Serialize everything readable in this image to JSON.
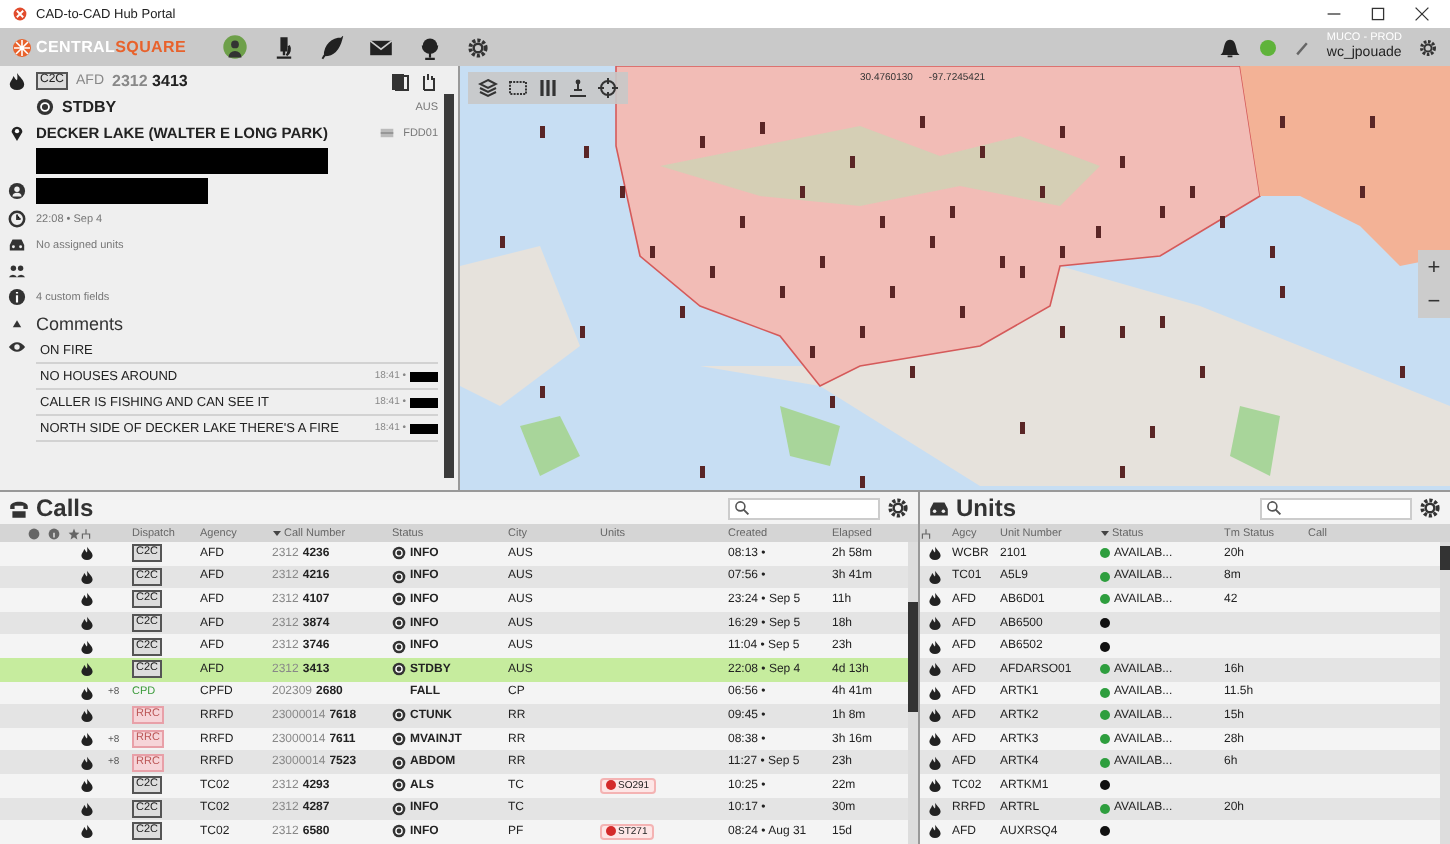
{
  "window": {
    "title": "CAD-to-CAD Hub Portal"
  },
  "toolbar": {
    "logo_main": "CENTRAL",
    "logo_accent": "SQUARE",
    "environment": "MUCO - PROD",
    "user": "wc_jpouade"
  },
  "incident": {
    "badge": "C2C",
    "agency": "AFD",
    "call_number": "2312 **3413**",
    "status": "STDBY",
    "city": "AUS",
    "location": "DECKER LAKE (WALTER E LONG PARK)",
    "location_code": "FDD01",
    "created": "22:08 • Sep 4",
    "units": "No assigned units",
    "custom_fields": "4 custom fields",
    "comments_title": "Comments",
    "comments": [
      {
        "text": "ON FIRE"
      },
      {
        "text": "NO HOUSES AROUND",
        "time": "18:41 •"
      },
      {
        "text": "CALLER IS FISHING AND CAN SEE IT",
        "time": "18:41 •"
      },
      {
        "text": "NORTH SIDE OF DECKER LAKE THERE'S A FIRE",
        "time": "18:41 •"
      }
    ]
  },
  "map": {
    "latitude": "30.4760130",
    "longitude": "-97.7245421",
    "zoom_in": "+",
    "zoom_out": "−"
  },
  "calls": {
    "title": "Calls",
    "columns": [
      {
        "label": "Dispatch",
        "sorted": false
      },
      {
        "label": "Agency",
        "sorted": false
      },
      {
        "label": "Call Number",
        "sorted": true
      },
      {
        "label": "Status",
        "sorted": false
      },
      {
        "label": "City",
        "sorted": false
      },
      {
        "label": "Units",
        "sorted": false
      },
      {
        "label": "Created",
        "sorted": false
      },
      {
        "label": "Elapsed",
        "sorted": false
      }
    ],
    "rows": [
      {
        "dispatch": "C2C",
        "kind": "c2c",
        "agency": "AFD",
        "call_number": "2312 **4236**",
        "status": "INFO",
        "status_icon": true,
        "city": "AUS",
        "created": "08:13 •",
        "elapsed": "2h 58m",
        "selected": false
      },
      {
        "dispatch": "C2C",
        "kind": "c2c",
        "agency": "AFD",
        "call_number": "2312 **4216**",
        "status": "INFO",
        "status_icon": true,
        "city": "AUS",
        "created": "07:56 •",
        "elapsed": "3h 41m",
        "selected": false
      },
      {
        "dispatch": "C2C",
        "kind": "c2c",
        "agency": "AFD",
        "call_number": "2312 **4107**",
        "status": "INFO",
        "status_icon": true,
        "city": "AUS",
        "created": "23:24 • Sep 5",
        "elapsed": "11h",
        "selected": false
      },
      {
        "dispatch": "C2C",
        "kind": "c2c",
        "agency": "AFD",
        "call_number": "2312 **3874**",
        "status": "INFO",
        "status_icon": true,
        "city": "AUS",
        "created": "16:29 • Sep 5",
        "elapsed": "18h",
        "selected": false
      },
      {
        "dispatch": "C2C",
        "kind": "c2c",
        "agency": "AFD",
        "call_number": "2312 **3746**",
        "status": "INFO",
        "status_icon": true,
        "city": "AUS",
        "created": "11:04 • Sep 5",
        "elapsed": "23h",
        "selected": false
      },
      {
        "dispatch": "C2C",
        "kind": "c2c",
        "agency": "AFD",
        "call_number": "2312 **3413**",
        "status": "STDBY",
        "status_icon": true,
        "city": "AUS",
        "created": "22:08 • Sep 4",
        "elapsed": "4d 13h",
        "selected": true
      },
      {
        "marker": "+8",
        "dispatch": "CPD",
        "kind": "cpd",
        "agency": "CPFD",
        "call_number": "202309 **2680**",
        "status": "FALL",
        "status_icon": false,
        "city": "CP",
        "created": "06:56 •",
        "elapsed": "4h 41m",
        "selected": false
      },
      {
        "dispatch": "RRC",
        "kind": "rrc",
        "agency": "RRFD",
        "call_number": "23000014 **7618**",
        "status": "CTUNK",
        "status_icon": true,
        "city": "RR",
        "created": "09:45 •",
        "elapsed": "1h 8m",
        "selected": false
      },
      {
        "marker": "+8",
        "dispatch": "RRC",
        "kind": "rrc",
        "agency": "RRFD",
        "call_number": "23000014 **7611**",
        "status": "MVAINJT",
        "status_icon": true,
        "city": "RR",
        "created": "08:38 •",
        "elapsed": "3h 16m",
        "selected": false
      },
      {
        "marker": "+8",
        "dispatch": "RRC",
        "kind": "rrc",
        "agency": "RRFD",
        "call_number": "23000014 **7523**",
        "status": "ABDOM",
        "status_icon": true,
        "city": "RR",
        "created": "11:27 • Sep 5",
        "elapsed": "23h",
        "selected": false
      },
      {
        "dispatch": "C2C",
        "kind": "c2c",
        "agency": "TC02",
        "call_number": "2312 **4293**",
        "status": "ALS",
        "status_icon": true,
        "city": "TC",
        "unit": {
          "label": "SO291",
          "color": "#d42a2a"
        },
        "created": "10:25 •",
        "elapsed": "22m",
        "selected": false
      },
      {
        "dispatch": "C2C",
        "kind": "c2c",
        "agency": "TC02",
        "call_number": "2312 **4287**",
        "status": "INFO",
        "status_icon": true,
        "city": "TC",
        "created": "10:17 •",
        "elapsed": "30m",
        "selected": false
      },
      {
        "dispatch": "C2C",
        "kind": "c2c",
        "agency": "TC02",
        "call_number": "2312 **6580**",
        "status": "INFO",
        "status_icon": true,
        "city": "PF",
        "unit": {
          "label": "ST271",
          "color": "#d42a2a"
        },
        "created": "08:24 • Aug 31",
        "elapsed": "15d",
        "selected": false
      }
    ]
  },
  "units": {
    "title": "Units",
    "columns": [
      {
        "label": "Agcy",
        "sorted": false
      },
      {
        "label": "Unit Number",
        "sorted": false
      },
      {
        "label": "Status",
        "sorted": true
      },
      {
        "label": "Tm Status",
        "sorted": false
      },
      {
        "label": "Call",
        "sorted": false
      }
    ],
    "rows": [
      {
        "agency": "WCBR",
        "unit": "2101",
        "status": "AVAILAB...",
        "color": "#2e9e3e",
        "time": "20h"
      },
      {
        "agency": "TC01",
        "unit": "A5L9",
        "status": "AVAILAB...",
        "color": "#2e9e3e",
        "time": "8m"
      },
      {
        "agency": "AFD",
        "unit": "AB6D01",
        "status": "AVAILAB...",
        "color": "#2e9e3e",
        "time": "42"
      },
      {
        "agency": "AFD",
        "unit": "AB6500",
        "color": "#111111"
      },
      {
        "agency": "AFD",
        "unit": "AB6502",
        "color": "#111111"
      },
      {
        "agency": "AFD",
        "unit": "AFDARSO01",
        "status": "AVAILAB...",
        "color": "#2e9e3e",
        "time": "16h"
      },
      {
        "agency": "AFD",
        "unit": "ARTK1",
        "status": "AVAILAB...",
        "color": "#2e9e3e",
        "time": "11.5h"
      },
      {
        "agency": "AFD",
        "unit": "ARTK2",
        "status": "AVAILAB...",
        "color": "#2e9e3e",
        "time": "15h"
      },
      {
        "agency": "AFD",
        "unit": "ARTK3",
        "status": "AVAILAB...",
        "color": "#2e9e3e",
        "time": "28h"
      },
      {
        "agency": "AFD",
        "unit": "ARTK4",
        "status": "AVAILAB...",
        "color": "#2e9e3e",
        "time": "6h"
      },
      {
        "agency": "TC02",
        "unit": "ARTKM1",
        "color": "#111111"
      },
      {
        "agency": "RRFD",
        "unit": "ARTRL",
        "status": "AVAILAB...",
        "color": "#2e9e3e",
        "time": "20h"
      },
      {
        "agency": "AFD",
        "unit": "AUXRSQ4",
        "color": "#111111"
      }
    ]
  }
}
